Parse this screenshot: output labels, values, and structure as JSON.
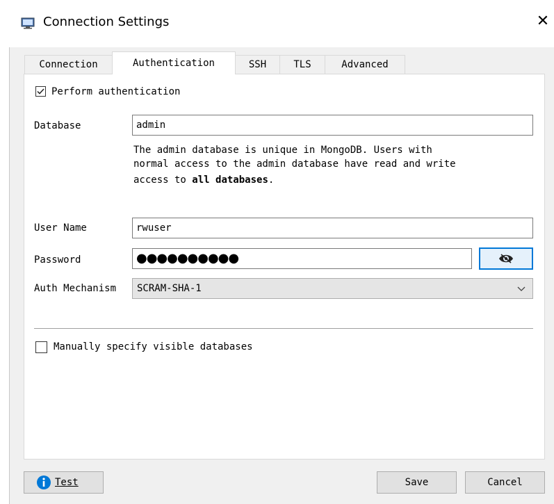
{
  "window": {
    "title": "Connection Settings"
  },
  "tabs": [
    {
      "label": "Connection"
    },
    {
      "label": "Authentication"
    },
    {
      "label": "SSH"
    },
    {
      "label": "TLS"
    },
    {
      "label": "Advanced"
    }
  ],
  "auth": {
    "perform_auth_label": "Perform authentication",
    "perform_auth_checked": true,
    "database_label": "Database",
    "database_value": "admin",
    "help_text_1": "The  admin  database  is  unique  in  MongoDB. Users with",
    "help_text_2": "normal access to the admin database have read and write",
    "help_text_3_prefix": "access to ",
    "help_text_3_bold": "all databases",
    "help_text_3_suffix": ".",
    "username_label": "User Name",
    "username_value": "rwuser",
    "password_label": "Password",
    "password_masked": "●●●●●●●●●●",
    "mechanism_label": "Auth Mechanism",
    "mechanism_value": "SCRAM-SHA-1",
    "visible_db_label": "Manually specify visible databases",
    "visible_db_checked": false
  },
  "footer": {
    "test_label": "Test",
    "save_label": "Save",
    "cancel_label": "Cancel"
  },
  "icons": {
    "app": "monitor-icon",
    "close": "close-icon",
    "show_password": "eye-icon",
    "dropdown": "chevron-down-icon",
    "info": "info-icon"
  },
  "colors": {
    "info_blue": "#0078d7",
    "focus_border": "#0078d7"
  }
}
